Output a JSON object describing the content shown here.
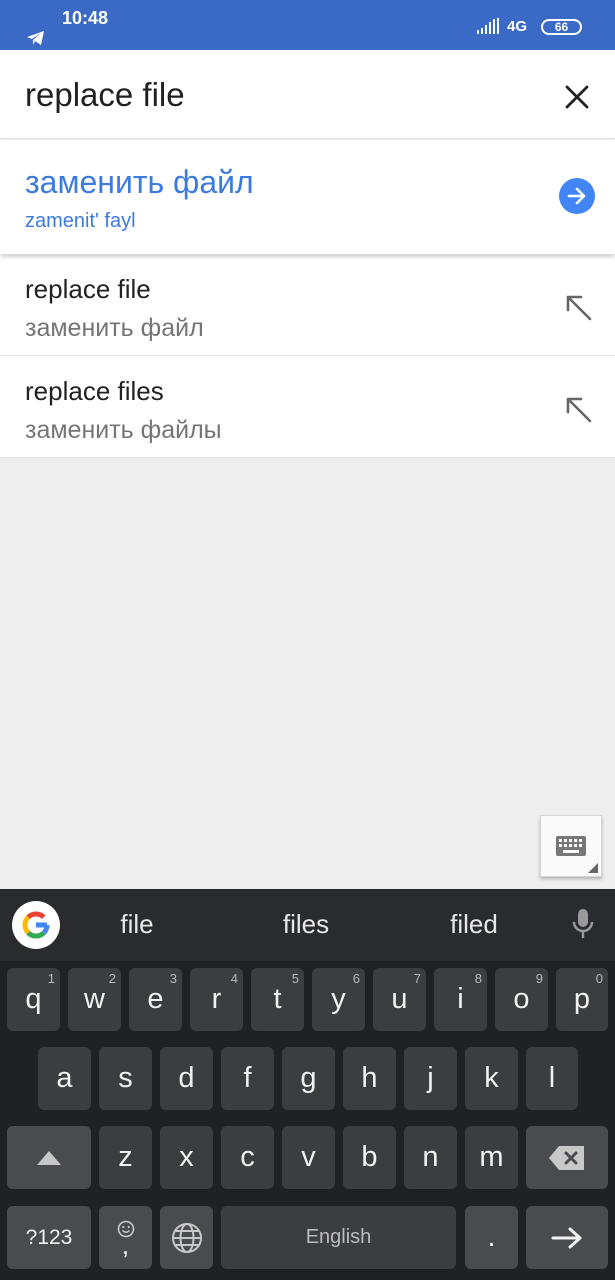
{
  "status_bar": {
    "time": "10:48",
    "network": "4G",
    "battery": "66"
  },
  "search": {
    "query": "replace file"
  },
  "translation": {
    "text": "заменить файл",
    "transliteration": "zamenit' fayl"
  },
  "suggestions": [
    {
      "source": "replace file",
      "target": "заменить файл"
    },
    {
      "source": "replace files",
      "target": "заменить файлы"
    }
  ],
  "keyboard": {
    "suggestions": [
      "file",
      "files",
      "filed"
    ],
    "row1": [
      {
        "k": "q",
        "h": "1"
      },
      {
        "k": "w",
        "h": "2"
      },
      {
        "k": "e",
        "h": "3"
      },
      {
        "k": "r",
        "h": "4"
      },
      {
        "k": "t",
        "h": "5"
      },
      {
        "k": "y",
        "h": "6"
      },
      {
        "k": "u",
        "h": "7"
      },
      {
        "k": "i",
        "h": "8"
      },
      {
        "k": "o",
        "h": "9"
      },
      {
        "k": "p",
        "h": "0"
      }
    ],
    "row2": [
      "a",
      "s",
      "d",
      "f",
      "g",
      "h",
      "j",
      "k",
      "l"
    ],
    "row3": [
      "z",
      "x",
      "c",
      "v",
      "b",
      "n",
      "m"
    ],
    "symbols_label": "?123",
    "emoji_comma": ",",
    "space_label": "English",
    "period_label": "."
  },
  "colors": {
    "status_bar": "#3a6ac5",
    "accent_blue": "#3b7be0",
    "keyboard_bg": "#202124",
    "key_bg": "#3c3d40"
  }
}
